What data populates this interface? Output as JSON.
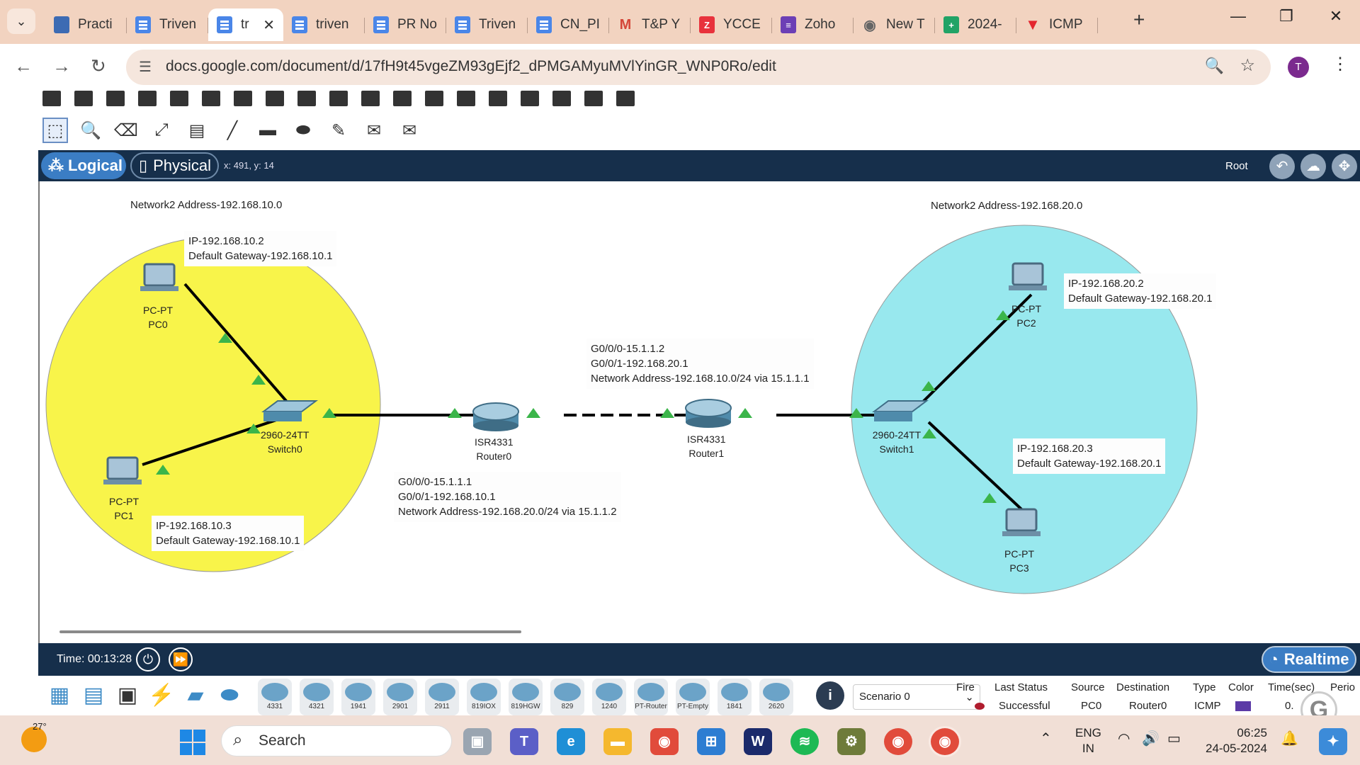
{
  "browser": {
    "tabs": [
      {
        "label": "Practi",
        "icon": "classroom-icon",
        "active": false
      },
      {
        "label": "Triven",
        "icon": "docs-icon",
        "active": false
      },
      {
        "label": "tr",
        "icon": "docs-icon",
        "active": true
      },
      {
        "label": "triven",
        "icon": "docs-icon",
        "active": false
      },
      {
        "label": "PR No",
        "icon": "docs-icon",
        "active": false
      },
      {
        "label": "Triven",
        "icon": "docs-icon",
        "active": false
      },
      {
        "label": "CN_PI",
        "icon": "docs-icon",
        "active": false
      },
      {
        "label": "T&P Y",
        "icon": "gmail-icon",
        "active": false
      },
      {
        "label": "YCCE",
        "icon": "z-icon",
        "active": false
      },
      {
        "label": "Zoho",
        "icon": "zoho-icon",
        "active": false
      },
      {
        "label": "New T",
        "icon": "chrome-icon",
        "active": false
      },
      {
        "label": "2024-",
        "icon": "sheets-icon",
        "active": false
      },
      {
        "label": "ICMP",
        "icon": "v-icon",
        "active": false
      }
    ],
    "url": "docs.google.com/document/d/17fH9t45vgeZM93gEjf2_dPMGAMyuMVlYinGR_WNP0Ro/edit",
    "profile_initial": "T"
  },
  "pt": {
    "views": {
      "logical": "Logical",
      "physical": "Physical"
    },
    "coords": "x: 491, y: 14",
    "root": "Root",
    "zones": {
      "left_color": "#f8f44a",
      "right_color": "#98e8ee"
    },
    "networks": {
      "left": "Network2 Address-192.168.10.0",
      "right": "Network2 Address-192.168.20.0"
    },
    "devices": {
      "pc0": {
        "model": "PC-PT",
        "name": "PC0"
      },
      "pc1": {
        "model": "PC-PT",
        "name": "PC1"
      },
      "pc2": {
        "model": "PC-PT",
        "name": "PC2"
      },
      "pc3": {
        "model": "PC-PT",
        "name": "PC3"
      },
      "switch0": {
        "model": "2960-24TT",
        "name": "Switch0"
      },
      "switch1": {
        "model": "2960-24TT",
        "name": "Switch1"
      },
      "router0": {
        "model": "ISR4331",
        "name": "Router0"
      },
      "router1": {
        "model": "ISR4331",
        "name": "Router1"
      }
    },
    "notes": {
      "pc0": [
        "IP-192.168.10.2",
        "Default Gateway-192.168.10.1"
      ],
      "pc1": [
        "IP-192.168.10.3",
        "Default Gateway-192.168.10.1"
      ],
      "pc2": [
        "IP-192.168.20.2",
        "Default Gateway-192.168.20.1"
      ],
      "pc3": [
        "IP-192.168.20.3",
        "Default Gateway-192.168.20.1"
      ],
      "router0": [
        "G0/0/0-15.1.1.1",
        "G0/0/1-192.168.10.1",
        "Network Address-192.168.20.0/24 via 15.1.1.2"
      ],
      "router1": [
        "G0/0/0-15.1.1.2",
        "G0/0/1-192.168.20.1",
        "Network Address-192.168.10.0/24 via 15.1.1.1"
      ]
    },
    "time": "Time: 00:13:28",
    "realtime": "Realtime",
    "device_models": [
      "4331",
      "4321",
      "1941",
      "2901",
      "2911",
      "819IOX",
      "819HGW",
      "829",
      "1240",
      "PT-Router",
      "PT-Empty",
      "1841",
      "2620"
    ],
    "scenario": "Scenario 0",
    "pdu": {
      "headers": [
        "Fire",
        "Last Status",
        "Source",
        "Destination",
        "Type",
        "Color",
        "Time(sec)",
        "Perio"
      ],
      "row": {
        "status": "Successful",
        "source": "PC0",
        "destination": "Router0",
        "type": "ICMP",
        "time": "0."
      }
    }
  },
  "taskbar": {
    "temp": "27°",
    "search": "Search",
    "lang1": "ENG",
    "lang2": "IN",
    "time": "06:25",
    "date": "24-05-2024"
  }
}
